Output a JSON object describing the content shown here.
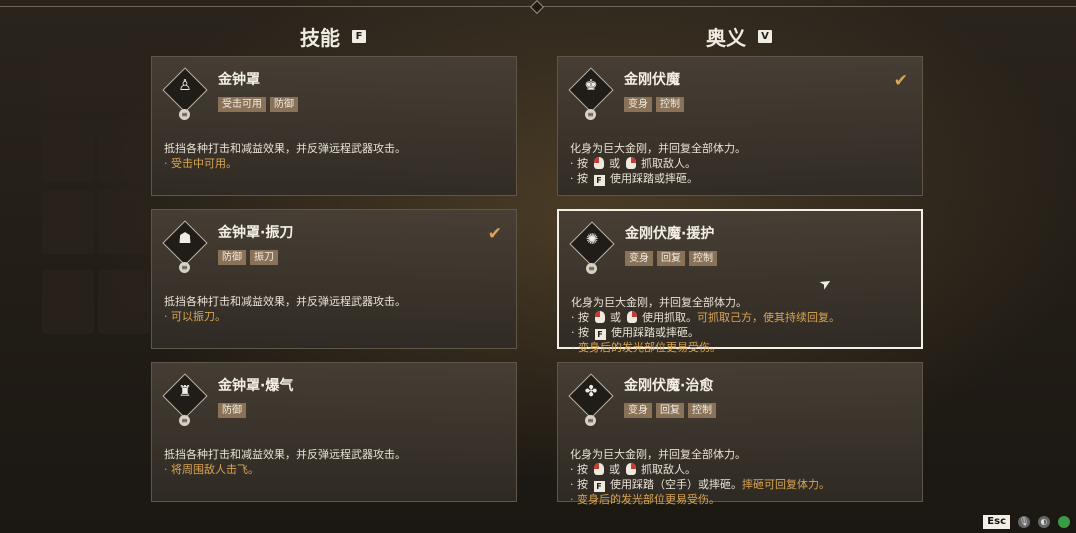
{
  "columns": [
    {
      "title": "技能",
      "key": "F"
    },
    {
      "title": "奥义",
      "key": "V"
    }
  ],
  "skills": [
    {
      "name": "金钟罩",
      "icon": "bell-figure-icon",
      "tags": [
        "受击可用",
        "防御"
      ],
      "selected": false,
      "checked": false,
      "lines": [
        {
          "text": "抵挡各种打击和减益效果，并反弹远程武器攻击。",
          "gold": false
        },
        {
          "text": "· 受击中可用。",
          "gold": true
        }
      ]
    },
    {
      "name": "金钟罩·振刀",
      "icon": "bell-shield-icon",
      "tags": [
        "防御",
        "振刀"
      ],
      "selected": false,
      "checked": true,
      "lines": [
        {
          "text": "抵挡各种打击和减益效果，并反弹远程武器攻击。",
          "gold": false
        },
        {
          "text": "· 可以振刀。",
          "gold": true
        }
      ]
    },
    {
      "name": "金钟罩·爆气",
      "icon": "bell-burst-icon",
      "tags": [
        "防御"
      ],
      "selected": false,
      "checked": false,
      "lines": [
        {
          "text": "抵挡各种打击和减益效果，并反弹远程武器攻击。",
          "gold": false
        },
        {
          "text": "· 将周围敌人击飞。",
          "gold": true
        }
      ]
    }
  ],
  "ultimates": [
    {
      "name": "金刚伏魔",
      "icon": "vajra-figure-icon",
      "tags": [
        "变身",
        "控制"
      ],
      "selected": false,
      "checked": true,
      "lines": [
        {
          "segments": [
            {
              "t": "化身为巨大金刚，并回复全部体力。"
            }
          ]
        },
        {
          "segments": [
            {
              "t": "· 按 "
            },
            {
              "mouse": "left"
            },
            {
              "t": " 或 "
            },
            {
              "mouse": "right"
            },
            {
              "t": " 抓取敌人。"
            }
          ]
        },
        {
          "segments": [
            {
              "t": "· 按 "
            },
            {
              "key": "F"
            },
            {
              "t": " 使用踩踏或摔砸。"
            }
          ]
        }
      ]
    },
    {
      "name": "金刚伏魔·援护",
      "icon": "vajra-multiarm-icon",
      "tags": [
        "变身",
        "回复",
        "控制"
      ],
      "selected": true,
      "checked": false,
      "lines": [
        {
          "segments": [
            {
              "t": "化身为巨大金刚，并回复全部体力。"
            }
          ]
        },
        {
          "segments": [
            {
              "t": "· 按 "
            },
            {
              "mouse": "left"
            },
            {
              "t": " 或 "
            },
            {
              "mouse": "right"
            },
            {
              "t": " 使用抓取。"
            },
            {
              "t": "可抓取己方，使其持续回复。",
              "gold": true
            }
          ]
        },
        {
          "segments": [
            {
              "t": "· 按 "
            },
            {
              "key": "F"
            },
            {
              "t": " 使用踩踏或摔砸。"
            }
          ]
        },
        {
          "segments": [
            {
              "t": "· 变身后的发光部位更易受伤。",
              "gold": true
            }
          ]
        }
      ]
    },
    {
      "name": "金刚伏魔·治愈",
      "icon": "vajra-heal-icon",
      "tags": [
        "变身",
        "回复",
        "控制"
      ],
      "selected": false,
      "checked": false,
      "lines": [
        {
          "segments": [
            {
              "t": "化身为巨大金刚，并回复全部体力。"
            }
          ]
        },
        {
          "segments": [
            {
              "t": "· 按 "
            },
            {
              "mouse": "left"
            },
            {
              "t": " 或 "
            },
            {
              "mouse": "right"
            },
            {
              "t": " 抓取敌人。"
            }
          ]
        },
        {
          "segments": [
            {
              "t": "· 按 "
            },
            {
              "key": "F"
            },
            {
              "t": " 使用踩踏（空手）或摔砸。"
            },
            {
              "t": "摔砸可回复体力。",
              "gold": true
            }
          ]
        },
        {
          "segments": [
            {
              "t": "· 变身后的发光部位更易受伤。",
              "gold": true
            }
          ]
        }
      ]
    }
  ],
  "hint": {
    "esc": "Esc"
  }
}
